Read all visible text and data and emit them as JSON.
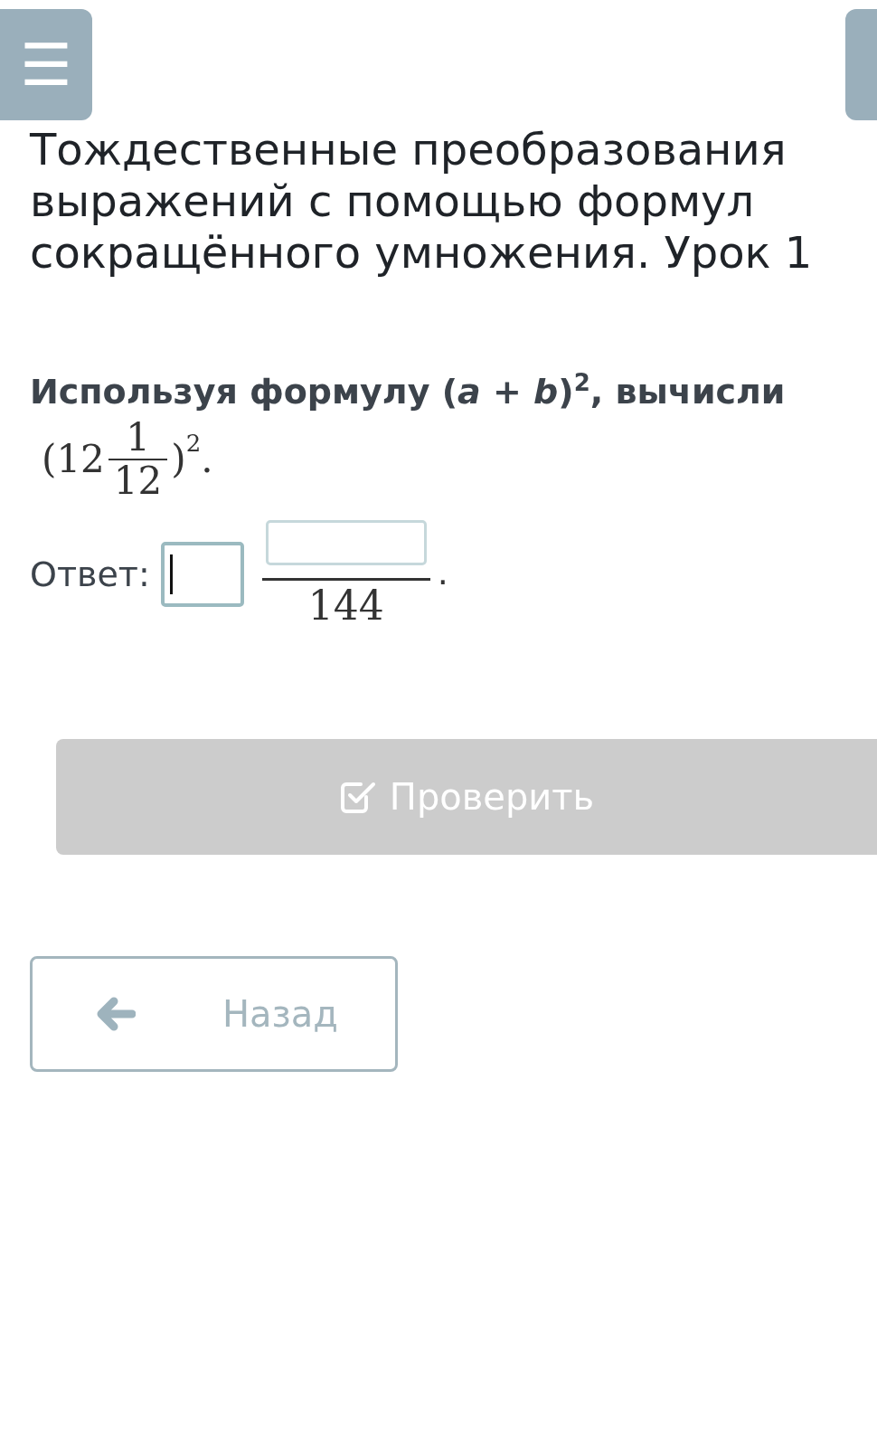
{
  "menu_button": {
    "icon": "☰"
  },
  "title": "Тождественные преобразования выражений с помощью формул сокращённого умножения. Урок 1",
  "question": "Используя формулу (*a* + *b*)$^{2}$, вычисли",
  "expression": {
    "open": "(",
    "whole": "12",
    "numerator": "1",
    "denominator": "12",
    "close": ")",
    "exponent": "2",
    "end": "."
  },
  "answer": {
    "label": "Ответ:",
    "whole_field": {
      "focused": true
    },
    "numerator_field": {
      "focused": false
    },
    "denominator": "144",
    "end": "."
  },
  "check_button": {
    "label": "Проверить",
    "disabled": true
  },
  "back_button": {
    "label": "Назад"
  }
}
